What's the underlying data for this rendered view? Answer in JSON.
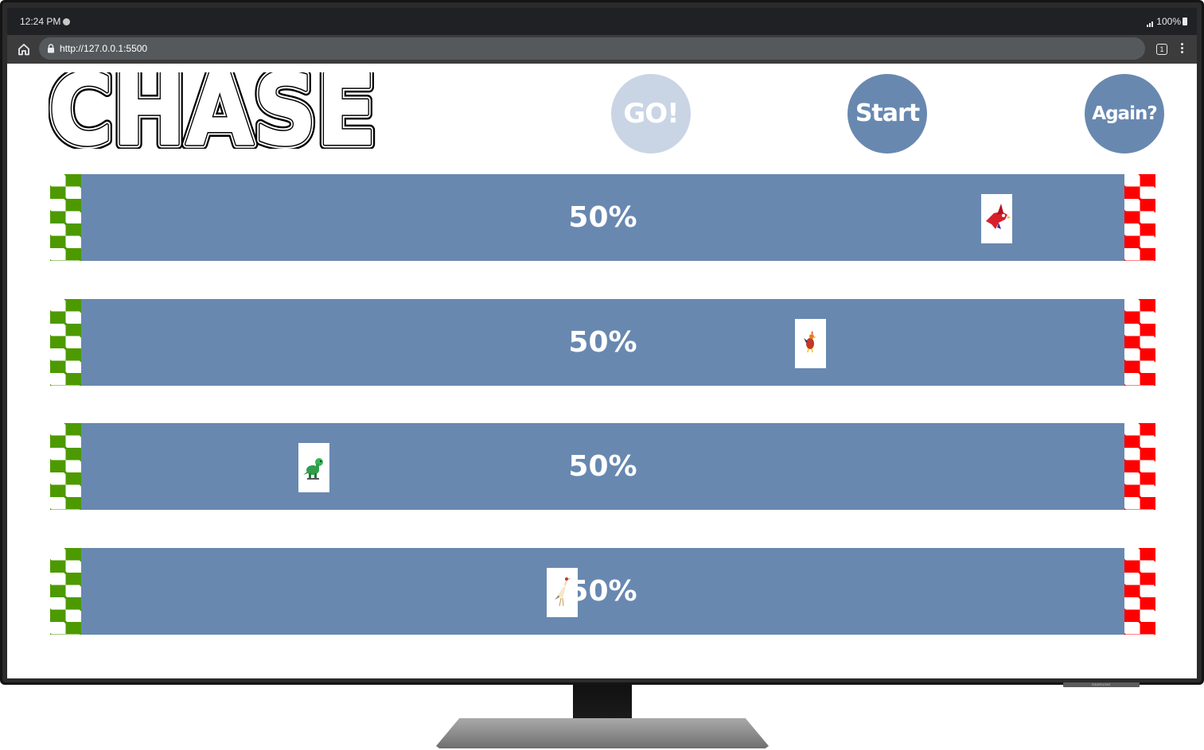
{
  "status_bar": {
    "time": "12:24 PM",
    "battery": "100%"
  },
  "browser": {
    "url": "http://127.0.0.1:5500",
    "tab_count": "1"
  },
  "page": {
    "logo_text": "CHASE",
    "buttons": {
      "go": "GO!",
      "start": "Start",
      "again": "Again?"
    },
    "lanes": [
      {
        "percent_label": "50%",
        "racer": "red-bird-icon"
      },
      {
        "percent_label": "50%",
        "racer": "rooster-icon"
      },
      {
        "percent_label": "50%",
        "racer": "green-dinosaur-icon"
      },
      {
        "percent_label": "50%",
        "racer": "crane-bird-icon"
      }
    ]
  },
  "colors": {
    "track": "#6888b0",
    "button_active": "#6888b0",
    "button_disabled": "#c9d5e4",
    "start_flag": "#4c9a00",
    "finish_flag": "#ff0000"
  }
}
